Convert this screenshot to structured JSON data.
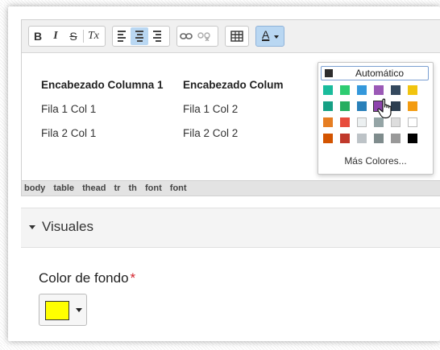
{
  "toolbar": {
    "bold": "B",
    "italic": "I",
    "strike": "S",
    "clear_format": "Tx",
    "color_label": "A"
  },
  "table": {
    "headers": [
      "Encabezado Columna 1",
      "Encabezado Colum"
    ],
    "rows": [
      [
        "Fila 1 Col 1",
        "Fila 1 Col 2"
      ],
      [
        "Fila 2 Col 1",
        "Fila 2 Col 2"
      ]
    ]
  },
  "pathbar": [
    "body",
    "table",
    "thead",
    "tr",
    "th",
    "font",
    "font"
  ],
  "color_picker": {
    "automatic_label": "Automático",
    "more_colors_label": "Más Colores...",
    "swatches": [
      [
        "#1abc9c",
        "#2ecc71",
        "#3498db",
        "#9b59b6",
        "#34495e",
        "#f1c40f"
      ],
      [
        "#16a085",
        "#27ae60",
        "#2980b9",
        "#8e44ad",
        "#2c3e50",
        "#f39c12"
      ],
      [
        "#e67e22",
        "#e74c3c",
        "#ecf0f1",
        "#95a5a6",
        "#dddddd",
        "#ffffff"
      ],
      [
        "#d35400",
        "#c0392b",
        "#bdc3c7",
        "#7f8c8d",
        "#999999",
        "#000000"
      ]
    ]
  },
  "section": {
    "title": "Visuales"
  },
  "background_color": {
    "label": "Color de fondo",
    "required_mark": "*",
    "value": "#ffff00"
  },
  "colors": {
    "active_button": "#b9d7f2",
    "required": "#d3202a"
  }
}
